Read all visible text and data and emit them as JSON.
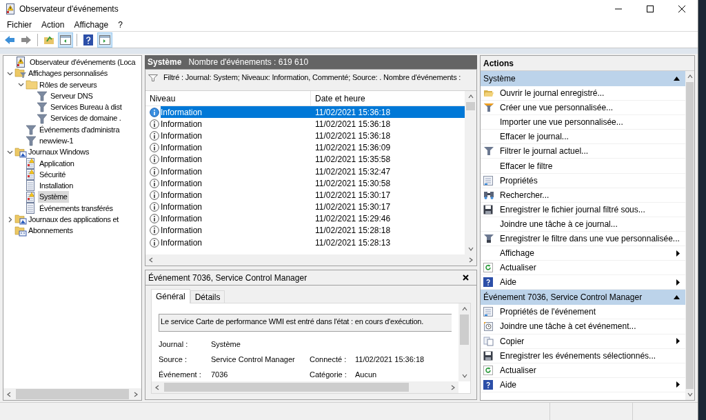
{
  "window": {
    "title": "Observateur d'événements"
  },
  "menu": [
    "Fichier",
    "Action",
    "Affichage",
    "?"
  ],
  "toolbar": [
    {
      "kind": "back",
      "pressed": false
    },
    {
      "kind": "forward",
      "pressed": false
    },
    {
      "kind": "sep"
    },
    {
      "kind": "up",
      "pressed": false
    },
    {
      "kind": "tree",
      "pressed": true
    },
    {
      "kind": "sep"
    },
    {
      "kind": "help",
      "pressed": false
    },
    {
      "kind": "actions",
      "pressed": true
    }
  ],
  "tree": [
    {
      "label": "Observateur d'événements (Loca",
      "kind": "viewer",
      "selected": false,
      "children": [
        {
          "label": "Affichages personnalisés",
          "kind": "filterfolder",
          "expanded": true,
          "selected": false,
          "children": [
            {
              "label": "Rôles de serveurs",
              "kind": "folder",
              "expanded": true,
              "selected": false,
              "children": [
                {
                  "label": "Serveur DNS",
                  "kind": "filter",
                  "selected": false
                },
                {
                  "label": "Services Bureau à dist",
                  "kind": "filter",
                  "selected": false
                },
                {
                  "label": "Services de domaine .",
                  "kind": "filter",
                  "selected": false
                }
              ]
            },
            {
              "label": "Événements d'administra",
              "kind": "filter",
              "selected": false
            },
            {
              "label": "newview-1",
              "kind": "filter",
              "selected": false
            }
          ]
        },
        {
          "label": "Journaux Windows",
          "kind": "logfolder",
          "expanded": true,
          "selected": false,
          "children": [
            {
              "label": "Application",
              "kind": "warnlog",
              "selected": false
            },
            {
              "label": "Sécurité",
              "kind": "warnlog",
              "selected": false
            },
            {
              "label": "Installation",
              "kind": "log",
              "selected": false
            },
            {
              "label": "Système",
              "kind": "warnlog",
              "selected": true
            },
            {
              "label": "Événements transférés",
              "kind": "log",
              "selected": false
            }
          ]
        },
        {
          "label": "Journaux des applications et",
          "kind": "logfolder",
          "expanded": false,
          "selected": false
        },
        {
          "label": "Abonnements",
          "kind": "subs",
          "selected": false
        }
      ]
    }
  ],
  "list_header": {
    "title": "Système",
    "count": "Nombre d'événements : 619 610"
  },
  "filter_text": "Filtré : Journal: System; Niveaux: Information, Commenté; Source: . Nombre d'événements :",
  "columns": [
    "Niveau",
    "Date et heure"
  ],
  "rows": [
    {
      "level": "Information",
      "date": "11/02/2021 15:36:18",
      "selected": true
    },
    {
      "level": "Information",
      "date": "11/02/2021 15:36:18",
      "selected": false
    },
    {
      "level": "Information",
      "date": "11/02/2021 15:36:18",
      "selected": false
    },
    {
      "level": "Information",
      "date": "11/02/2021 15:36:09",
      "selected": false
    },
    {
      "level": "Information",
      "date": "11/02/2021 15:35:58",
      "selected": false
    },
    {
      "level": "Information",
      "date": "11/02/2021 15:32:47",
      "selected": false
    },
    {
      "level": "Information",
      "date": "11/02/2021 15:30:58",
      "selected": false
    },
    {
      "level": "Information",
      "date": "11/02/2021 15:30:17",
      "selected": false
    },
    {
      "level": "Information",
      "date": "11/02/2021 15:30:17",
      "selected": false
    },
    {
      "level": "Information",
      "date": "11/02/2021 15:29:46",
      "selected": false
    },
    {
      "level": "Information",
      "date": "11/02/2021 15:28:18",
      "selected": false
    },
    {
      "level": "Information",
      "date": "11/02/2021 15:28:13",
      "selected": false
    }
  ],
  "detail": {
    "title": "Événement 7036, Service Control Manager",
    "tabs": [
      {
        "label": "Général",
        "selected": true
      },
      {
        "label": "Détails",
        "selected": false
      }
    ],
    "message": "Le service Carte de performance WMI est entré dans l'état : en cours d'exécution.",
    "fields": [
      [
        {
          "label": "Journal :",
          "value": "Système"
        }
      ],
      [
        {
          "label": "Source :",
          "value": "Service Control Manager"
        },
        {
          "label": "Connecté :",
          "value": "11/02/2021 15:36:18"
        }
      ],
      [
        {
          "label": "Événement :",
          "value": "7036"
        },
        {
          "label": "Catégorie :",
          "value": "Aucun"
        }
      ]
    ]
  },
  "actions": {
    "title": "Actions",
    "sections": [
      {
        "title": "Système",
        "items": [
          {
            "label": "Ouvrir le journal enregistré...",
            "kind": "open",
            "submenu": false
          },
          {
            "label": "Créer une vue personnalisée...",
            "kind": "filtercolor",
            "submenu": false
          },
          {
            "label": "Importer une vue personnalisée...",
            "kind": "none",
            "submenu": false
          },
          {
            "label": "Effacer le journal...",
            "kind": "none",
            "submenu": false
          },
          {
            "label": "Filtrer le journal actuel...",
            "kind": "filter",
            "submenu": false
          },
          {
            "label": "Effacer le filtre",
            "kind": "none",
            "submenu": false
          },
          {
            "label": "Propriétés",
            "kind": "props",
            "submenu": false
          },
          {
            "label": "Rechercher...",
            "kind": "find",
            "submenu": false
          },
          {
            "label": "Enregistrer le fichier journal filtré sous...",
            "kind": "save",
            "submenu": false
          },
          {
            "label": "Joindre une tâche à ce journal...",
            "kind": "none",
            "submenu": false
          },
          {
            "label": "Enregistrer le filtre dans une vue personnalisée...",
            "kind": "savefilter",
            "submenu": false
          },
          {
            "label": "Affichage",
            "kind": "none",
            "submenu": true
          },
          {
            "label": "Actualiser",
            "kind": "refresh",
            "submenu": false
          },
          {
            "label": "Aide",
            "kind": "help",
            "submenu": true
          }
        ]
      },
      {
        "title": "Événement 7036, Service Control Manager",
        "items": [
          {
            "label": "Propriétés de l'événement",
            "kind": "props",
            "submenu": false
          },
          {
            "label": "Joindre une tâche à cet événement...",
            "kind": "task",
            "submenu": false
          },
          {
            "label": "Copier",
            "kind": "copy",
            "submenu": true
          },
          {
            "label": "Enregistrer les événements sélectionnés...",
            "kind": "save",
            "submenu": false
          },
          {
            "label": "Actualiser",
            "kind": "refresh",
            "submenu": false
          },
          {
            "label": "Aide",
            "kind": "help",
            "submenu": true
          }
        ]
      }
    ]
  }
}
